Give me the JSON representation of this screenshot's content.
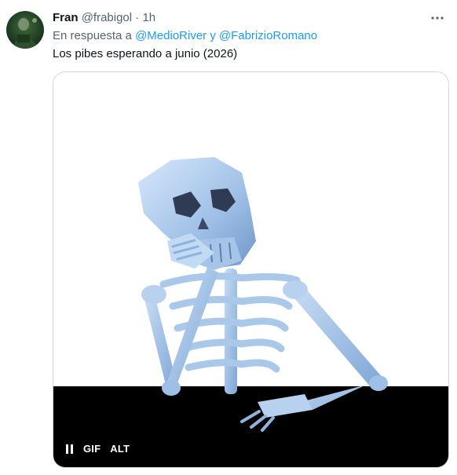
{
  "tweet": {
    "author_name": "Fran",
    "author_handle": "@frabigol",
    "separator": "·",
    "time": "1h",
    "reply_prefix": "En respuesta a",
    "reply_mention_1": "@MedioRiver",
    "reply_conjunction": "y",
    "reply_mention_2": "@FabrizioRomano",
    "text": "Los pibes esperando a junio (2026)"
  },
  "media": {
    "type": "gif",
    "gif_badge": "GIF",
    "alt_badge": "ALT",
    "pause_icon": "pause-icon"
  },
  "colors": {
    "text_primary": "#0f1419",
    "text_secondary": "#536471",
    "link": "#1d9bf0",
    "media_border": "#cfd9de",
    "skeleton": "#a9c8ea",
    "table": "#000000"
  },
  "icons": {
    "more": "more-dots-icon",
    "avatar": "avatar-image"
  }
}
